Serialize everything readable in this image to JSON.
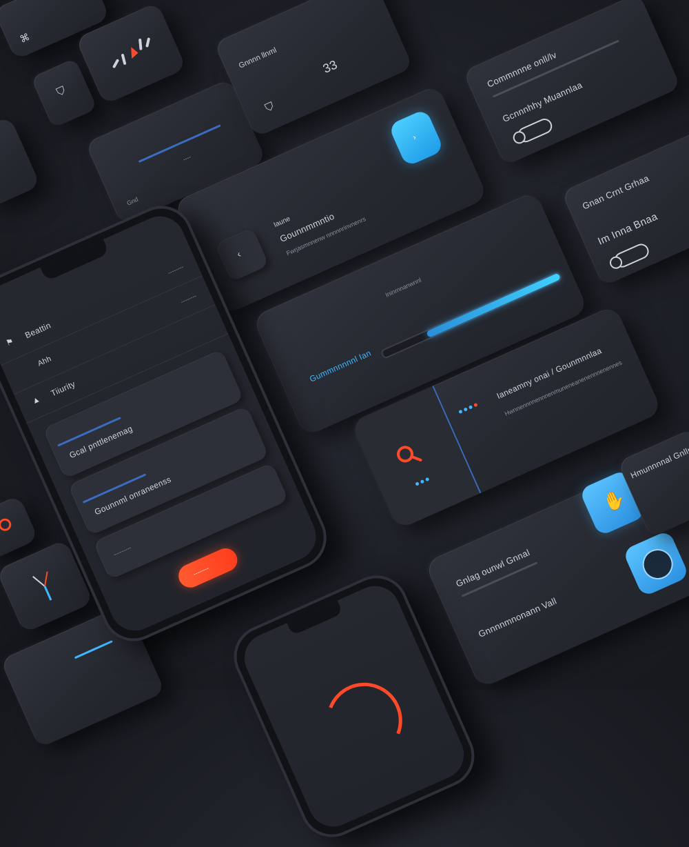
{
  "colors": {
    "accent_blue": "#3fb8ff",
    "accent_orange": "#ff4a2a",
    "card_bg": "#2a2c34",
    "background": "#1d1f26"
  },
  "phone": {
    "rows": [
      {
        "label": "Beattin",
        "value": "--------"
      },
      {
        "label": "Ahh",
        "value": "--------"
      },
      {
        "label": "Tiiurity",
        "value": ""
      }
    ],
    "cards": [
      {
        "title": "Gcal pnttlenemag",
        "value": "--------"
      },
      {
        "title": "Gounnml onraneenss",
        "value": "---------"
      }
    ],
    "button_label": "--------"
  },
  "main_card": {
    "title": "Iaune",
    "subtitle": "Gounnmmntio",
    "desc": "Fwrjasmnnenw nnnnnrinvnenrs"
  },
  "slider_card": {
    "label": "Gummnnnnnl Ian",
    "caption": "Ininrnnanwnnl",
    "value_pct": 75
  },
  "search_card": {
    "title": "Ianeamny onai / Gounmnnlaa",
    "desc": "Hwnnennnnennnenmuneneanenennnenennes"
  },
  "top_right_card": {
    "title": "Commnnne onll/lv",
    "subtitle": "Gcnnnhhy Muannlaa"
  },
  "right_card": {
    "title": "Gnan Crnt Grhaa",
    "subtitle": "Im Inna Bnaa"
  },
  "bottom_right_card": {
    "title1": "Gnlag ounwl Gnnal",
    "title2": "Gnnnnmnonann Vall",
    "side_title": "Hmunnnnal Gnlln"
  },
  "mini_card": {
    "value": "33",
    "label": "Gnnnn llnml"
  },
  "small_card": {
    "label": "Gnd",
    "value": "----"
  }
}
